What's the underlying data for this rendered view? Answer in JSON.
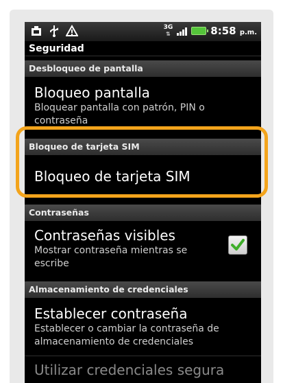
{
  "status_bar": {
    "network_type": "3G",
    "time": "8:58",
    "ampm": "p.m."
  },
  "screen_title": "Seguridad",
  "sections": {
    "screen_lock": "Desbloqueo de pantalla",
    "sim_lock": "Bloqueo de tarjeta SIM",
    "passwords": "Contraseñas",
    "credentials": "Almacenamiento de credenciales"
  },
  "items": {
    "screen_lock": {
      "title": "Bloqueo pantalla",
      "summary": "Bloquear pantalla con patrón, PIN o contraseña"
    },
    "sim_lock": {
      "title": "Bloqueo de tarjeta SIM"
    },
    "visible_passwords": {
      "title": "Contraseñas visibles",
      "summary": "Mostrar contraseña mientras se escribe",
      "checked": true
    },
    "set_password": {
      "title": "Establecer contraseña",
      "summary": "Establecer o cambiar la contraseña de almacenamiento de credenciales"
    },
    "use_secure_credentials": {
      "title": "Utilizar credenciales segura"
    }
  },
  "colors": {
    "highlight": "#f3a41c",
    "checkmark": "#3fae2a"
  },
  "icons": {
    "status_left": [
      "notification-icon",
      "usb-icon",
      "warning-icon"
    ],
    "status_right": [
      "signal-icon",
      "battery-icon"
    ],
    "checkbox": "checkmark-icon"
  }
}
